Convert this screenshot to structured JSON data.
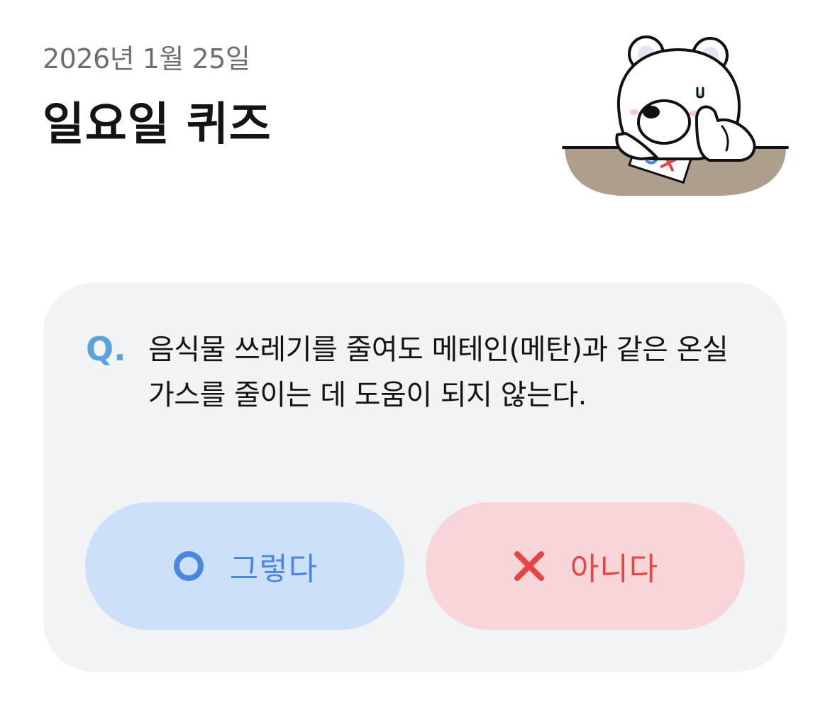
{
  "header": {
    "date": "2026년 1월 25일",
    "title": "일요일 퀴즈"
  },
  "mascot": {
    "icon": "polar-bear-quiz-icon",
    "paper_text": "OX"
  },
  "quiz": {
    "q_label": "Q.",
    "question": "음식물 쓰레기를 줄여도 메테인(메탄)과 같은 온실가스를 줄이는 데 도움이 되지 않는다.",
    "answers": [
      {
        "label": "그렇다",
        "icon": "circle-o-icon",
        "color": "#4b86e0",
        "bg": "#cde0fa"
      },
      {
        "label": "아니다",
        "icon": "x-mark-icon",
        "color": "#e64545",
        "bg": "#f8d5d8"
      }
    ]
  },
  "colors": {
    "accent_blue": "#5ba3db",
    "card_bg": "#f2f3f5"
  }
}
